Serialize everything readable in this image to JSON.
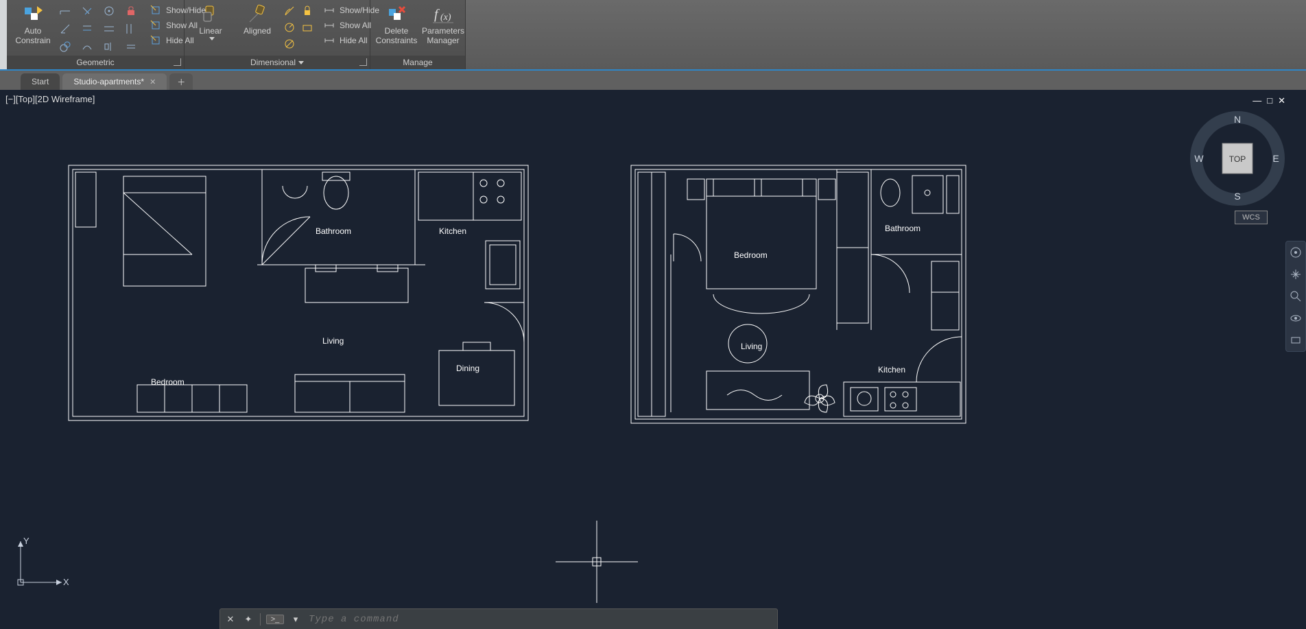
{
  "ribbon": {
    "auto_constrain": "Auto\nConstrain",
    "geo": {
      "show_hide": "Show/Hide",
      "show_all": "Show All",
      "hide_all": "Hide All",
      "title": "Geometric"
    },
    "dim": {
      "linear": "Linear",
      "aligned": "Aligned",
      "show_hide": "Show/Hide",
      "show_all": "Show All",
      "hide_all": "Hide All",
      "title": "Dimensional"
    },
    "manage": {
      "delete": "Delete\nConstraints",
      "params": "Parameters\nManager",
      "title": "Manage"
    }
  },
  "tabs": {
    "start": "Start",
    "file": "Studio-apartments*"
  },
  "viewport": {
    "label": "[−][Top][2D Wireframe]"
  },
  "viewcube": {
    "top": "TOP",
    "n": "N",
    "e": "E",
    "s": "S",
    "w": "W",
    "wcs": "WCS"
  },
  "cmd": {
    "placeholder": "Type a command"
  },
  "plan1": {
    "bedroom": "Bedroom",
    "bathroom": "Bathroom",
    "kitchen": "Kitchen",
    "living": "Living",
    "dining": "Dining"
  },
  "plan2": {
    "bedroom": "Bedroom",
    "bathroom": "Bathroom",
    "kitchen": "Kitchen",
    "living": "Living"
  }
}
